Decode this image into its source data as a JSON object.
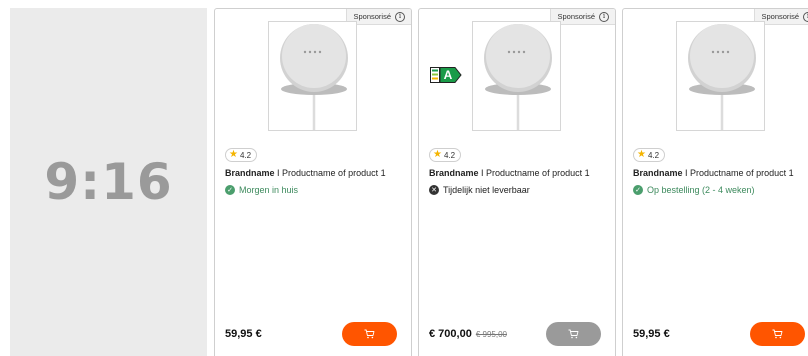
{
  "placeholder": {
    "ratio_label": "9:16"
  },
  "products": [
    {
      "sponsored_label": "Sponsorisé",
      "info_glyph": "i",
      "rating": "4.2",
      "brand": "Brandname",
      "separator": " I ",
      "name": "Productname of product 1",
      "availability": "Morgen in huis",
      "availability_status": "available",
      "price": "59,95 €",
      "energy_class": null,
      "cart_enabled": true
    },
    {
      "sponsored_label": "Sponsorisé",
      "info_glyph": "i",
      "rating": "4.2",
      "brand": "Brandname",
      "separator": " I ",
      "name": "Productname of product 1",
      "availability": "Tijdelijk niet leverbaar",
      "availability_status": "unavailable",
      "price": "€ 700,00",
      "old_price": "€ 995,00",
      "energy_class": "A",
      "cart_enabled": false
    },
    {
      "sponsored_label": "Sponsorisé",
      "info_glyph": "i",
      "rating": "4.2",
      "brand": "Brandname",
      "separator": " I ",
      "name": "Productname of product 1",
      "availability": "Op bestelling (2 - 4 weken)",
      "availability_status": "available",
      "price": "59,95 €",
      "energy_class": null,
      "cart_enabled": true
    }
  ],
  "colors": {
    "cart_active": "#ff5500",
    "cart_disabled": "#9a9a9a",
    "available_green": "#3d8a5d",
    "energy_green": "#1a9b48",
    "star": "#f4b400"
  },
  "icons": {
    "info": "info-icon",
    "star": "star-icon",
    "available": "check-circle-icon",
    "unavailable": "x-circle-icon",
    "cart": "cart-icon",
    "energy": "energy-label-icon"
  }
}
